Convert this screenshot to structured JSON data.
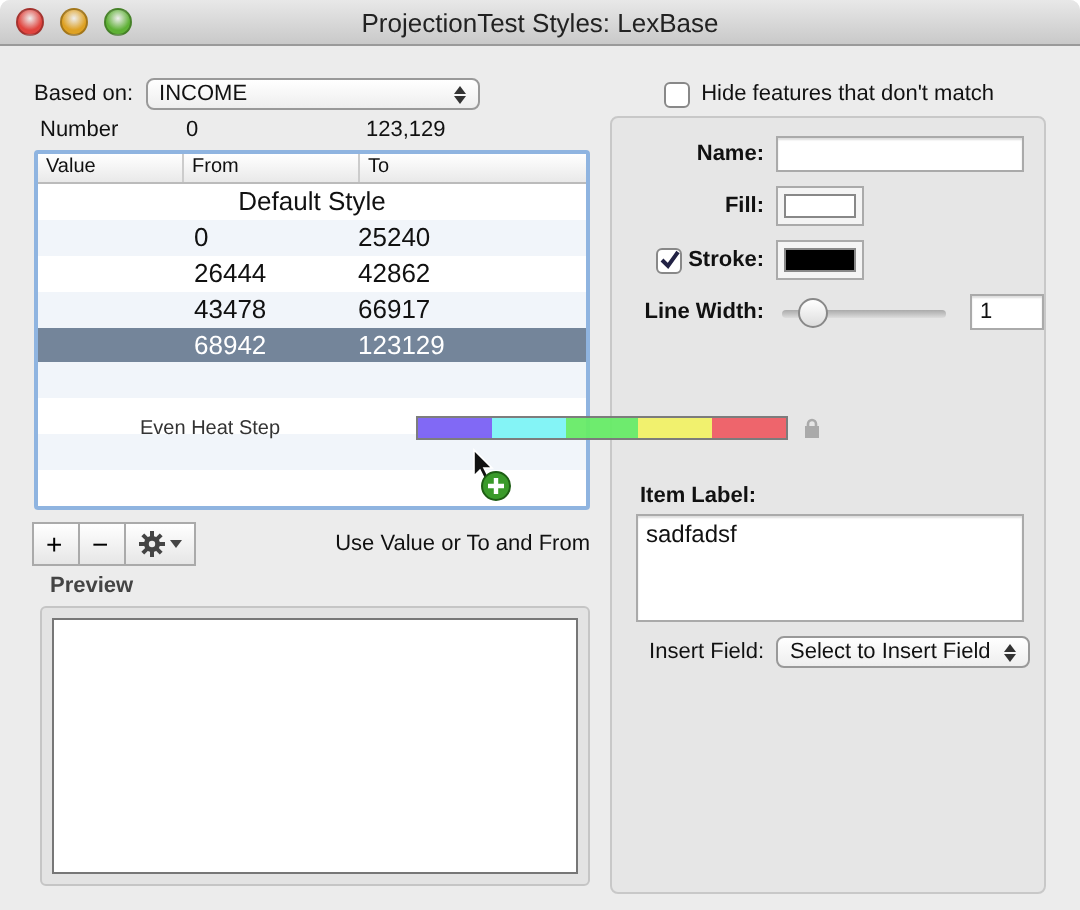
{
  "window": {
    "title": "ProjectionTest Styles: LexBase"
  },
  "based_on": {
    "label": "Based on:",
    "value": "INCOME"
  },
  "hide_features": {
    "label": "Hide features that don't match",
    "checked": false
  },
  "range_info": {
    "type": "Number",
    "min": "0",
    "max": "123,129"
  },
  "table": {
    "columns": [
      "Value",
      "From",
      "To"
    ],
    "rows": [
      {
        "kind": "default",
        "value": "Default Style",
        "selected": false
      },
      {
        "kind": "range",
        "from": "0",
        "to": "25240",
        "selected": false
      },
      {
        "kind": "range",
        "from": "26444",
        "to": "42862",
        "selected": false
      },
      {
        "kind": "range",
        "from": "43478",
        "to": "66917",
        "selected": false
      },
      {
        "kind": "range",
        "from": "68942",
        "to": "123129",
        "selected": true
      }
    ]
  },
  "drag_item": {
    "label": "Even Heat Step",
    "swatches": [
      {
        "color": "#7b61f5"
      },
      {
        "color": "#7ef4f6"
      },
      {
        "color": "#68ec68"
      },
      {
        "color": "#f2f268"
      },
      {
        "color": "#ef5f66"
      }
    ]
  },
  "toolbar": {
    "buttons": [
      "+",
      "−"
    ],
    "hint": "Use Value or To and From"
  },
  "preview": {
    "label": "Preview"
  },
  "style_panel": {
    "name_label": "Name:",
    "fill_label": "Fill:",
    "stroke_label": "Stroke:",
    "stroke_checked": true,
    "line_width_label": "Line Width:",
    "line_width": {
      "level": 0.15,
      "value": "1"
    },
    "item_label": "Item Label:",
    "item_label_value": "sadfadsf",
    "insert_field_label": "Insert Field:",
    "insert_field_value": "Select to Insert Field"
  }
}
